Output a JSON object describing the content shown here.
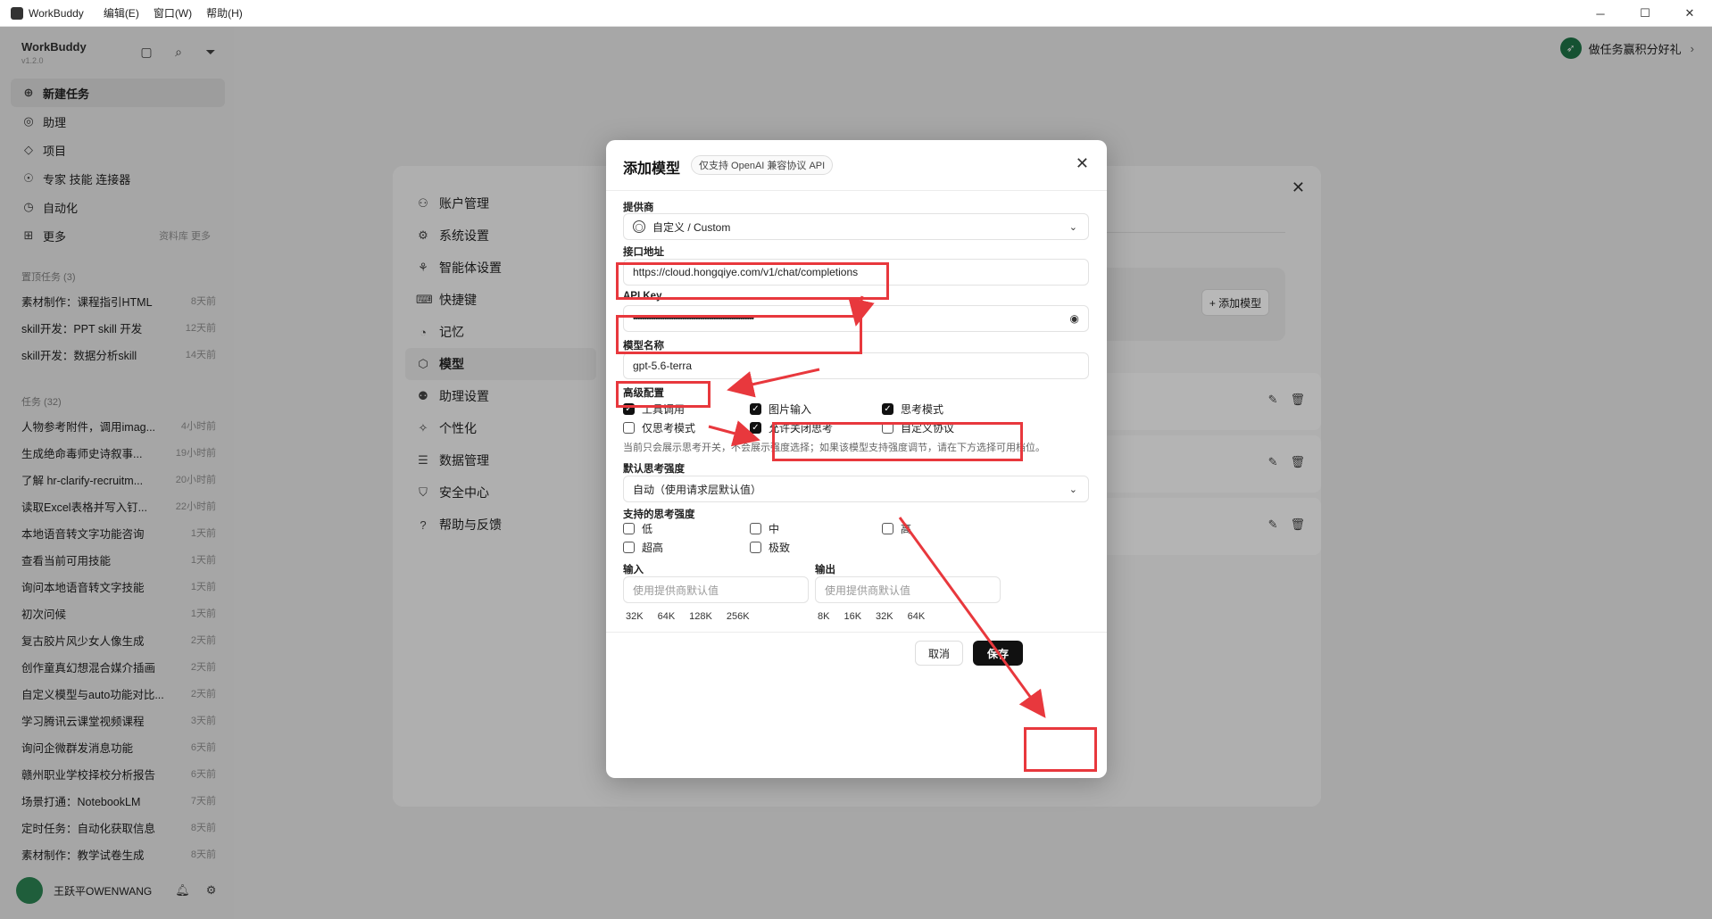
{
  "titlebar": {
    "app_name": "WorkBuddy",
    "menus": [
      "编辑(E)",
      "窗口(W)",
      "帮助(H)"
    ],
    "minimize": "─",
    "maximize": "☐",
    "close": "✕"
  },
  "sidebar": {
    "brand": "WorkBuddy",
    "version": "v1.2.0",
    "nav": [
      {
        "label": "新建任务",
        "icon": "plus-circle-icon"
      },
      {
        "label": "助理",
        "icon": "assistant-icon"
      },
      {
        "label": "项目",
        "icon": "project-icon"
      },
      {
        "label": "专家 技能 连接器",
        "icon": "expert-icon"
      },
      {
        "label": "自动化",
        "icon": "automation-icon"
      },
      {
        "label": "更多",
        "icon": "grid-icon",
        "extra": "资料库 更多"
      }
    ],
    "section_pinned": "置顶任务 (3)",
    "pinned": [
      {
        "title": "素材制作：课程指引HTML",
        "time": "8天前"
      },
      {
        "title": "skill开发：PPT skill 开发",
        "time": "12天前"
      },
      {
        "title": "skill开发：数据分析skill",
        "time": "14天前"
      }
    ],
    "section_tasks": "任务 (32)",
    "tasks": [
      {
        "title": "人物参考附件，调用imag...",
        "time": "4小时前"
      },
      {
        "title": "生成绝命毒师史诗叙事...",
        "time": "19小时前"
      },
      {
        "title": "了解 hr-clarify-recruitm...",
        "time": "20小时前"
      },
      {
        "title": "读取Excel表格并写入钉...",
        "time": "22小时前"
      },
      {
        "title": "本地语音转文字功能咨询",
        "time": "1天前"
      },
      {
        "title": "查看当前可用技能",
        "time": "1天前"
      },
      {
        "title": "询问本地语音转文字技能",
        "time": "1天前"
      },
      {
        "title": "初次问候",
        "time": "1天前"
      },
      {
        "title": "复古胶片风少女人像生成",
        "time": "2天前"
      },
      {
        "title": "创作童真幻想混合媒介插画",
        "time": "2天前"
      },
      {
        "title": "自定义模型与auto功能对比...",
        "time": "2天前"
      },
      {
        "title": "学习腾讯云课堂视频课程",
        "time": "3天前"
      },
      {
        "title": "询问企微群发消息功能",
        "time": "6天前"
      },
      {
        "title": "赣州职业学校择校分析报告",
        "time": "6天前"
      },
      {
        "title": "场景打通：NotebookLM",
        "time": "7天前"
      },
      {
        "title": "定时任务：自动化获取信息",
        "time": "8天前"
      },
      {
        "title": "素材制作：教学试卷生成",
        "time": "8天前"
      }
    ],
    "user_name": "王跃平OWENWANG"
  },
  "promo": {
    "label": "做任务赢积分好礼"
  },
  "settings": {
    "nav": [
      {
        "label": "账户管理",
        "icon": "user-icon"
      },
      {
        "label": "系统设置",
        "icon": "gear-icon"
      },
      {
        "label": "智能体设置",
        "icon": "agent-icon"
      },
      {
        "label": "快捷键",
        "icon": "keyboard-icon"
      },
      {
        "label": "记忆",
        "icon": "memory-icon"
      },
      {
        "label": "模型",
        "icon": "cube-icon"
      },
      {
        "label": "助理设置",
        "icon": "assistant-settings-icon"
      },
      {
        "label": "个性化",
        "icon": "sparkle-icon"
      },
      {
        "label": "数据管理",
        "icon": "database-icon"
      },
      {
        "label": "安全中心",
        "icon": "shield-icon"
      },
      {
        "label": "帮助与反馈",
        "icon": "help-icon"
      }
    ],
    "add_model_button": "+ 添加模型"
  },
  "dialog": {
    "title": "添加模型",
    "badge": "仅支持 OpenAI 兼容协议 API",
    "provider_label": "提供商",
    "provider_value": "自定义 / Custom",
    "endpoint_label": "接口地址",
    "endpoint_value": "https://cloud.hongqiye.com/v1/chat/completions",
    "apikey_label": "API Key",
    "apikey_value": "••••••••••••••••••••••••••••••••••••••••••••••••••••••",
    "model_name_label": "模型名称",
    "model_name_value": "gpt-5.6-terra",
    "advanced_label": "高级配置",
    "options": {
      "tool_call": "工具调用",
      "image_input": "图片输入",
      "thinking_mode": "思考模式",
      "thinking_only": "仅思考模式",
      "allow_close_thinking": "允许关闭思考",
      "custom_protocol": "自定义协议"
    },
    "hint": "当前只会展示思考开关，不会展示强度选择；如果该模型支持强度调节，请在下方选择可用档位。",
    "default_strength_label": "默认思考强度",
    "default_strength_value": "自动（使用请求层默认值）",
    "supported_strength_label": "支持的思考强度",
    "strengths": {
      "low": "低",
      "mid": "中",
      "high": "高",
      "xhigh": "超高",
      "max": "极致"
    },
    "input_label": "输入",
    "output_label": "输出",
    "input_placeholder": "使用提供商默认值",
    "output_placeholder": "使用提供商默认值",
    "input_chips": [
      "32K",
      "64K",
      "128K",
      "256K"
    ],
    "output_chips": [
      "8K",
      "16K",
      "32K",
      "64K"
    ],
    "cancel": "取消",
    "save": "保存"
  },
  "colors": {
    "highlight": "#e8383d",
    "primary": "#111111"
  }
}
